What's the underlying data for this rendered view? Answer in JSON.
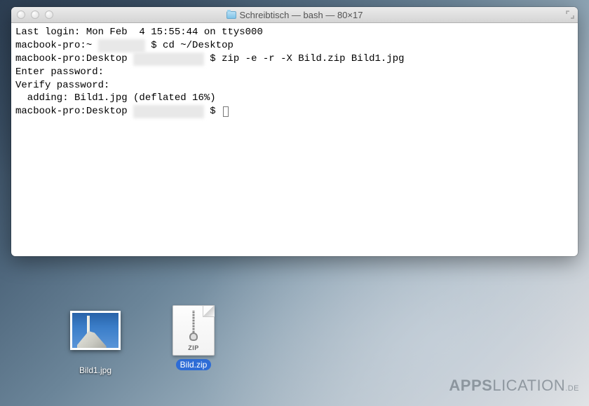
{
  "window": {
    "title": "Schreibtisch — bash — 80×17"
  },
  "terminal": {
    "lines": {
      "last_login": "Last login: Mon Feb  4 15:55:44 on ttys000",
      "prompt1_host": "macbook-pro:~ ",
      "prompt1_cmd": "$ cd ~/Desktop",
      "prompt2_host": "macbook-pro:Desktop ",
      "prompt2_cmd": "$ zip -e -r -X Bild.zip Bild1.jpg",
      "enter_pw": "Enter password: ",
      "verify_pw": "Verify password: ",
      "adding": "  adding: Bild1.jpg (deflated 16%)",
      "prompt3_host": "macbook-pro:Desktop ",
      "prompt3_cmd": "$ "
    }
  },
  "desktop": {
    "icons": [
      {
        "label": "Bild1.jpg",
        "type": "jpg",
        "selected": false
      },
      {
        "label": "Bild.zip",
        "type": "zip",
        "selected": true
      }
    ],
    "zip_badge": "ZIP"
  },
  "watermark": {
    "brand_bold": "APPS",
    "brand_rest": "LICATION",
    "tld": ".DE"
  }
}
